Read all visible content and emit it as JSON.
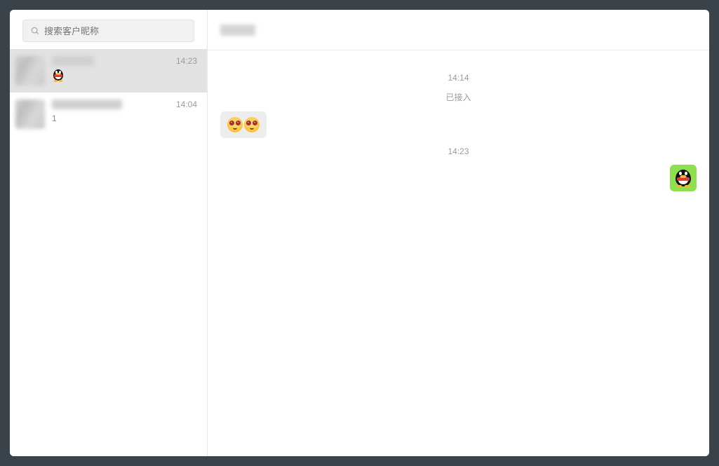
{
  "search": {
    "placeholder": "搜索客户昵称"
  },
  "conversations": [
    {
      "time": "14:23",
      "preview_icon": "penguin-icon",
      "preview_text": ""
    },
    {
      "time": "14:04",
      "preview_icon": null,
      "preview_text": "1"
    }
  ],
  "chat": {
    "timeline": [
      {
        "type": "time",
        "text": "14:14"
      },
      {
        "type": "system",
        "text": "已接入"
      },
      {
        "type": "msg",
        "side": "left",
        "emoji": "angry-eyes",
        "count": 2
      },
      {
        "type": "time",
        "text": "14:23"
      },
      {
        "type": "msg",
        "side": "right",
        "icon": "penguin-icon"
      }
    ]
  },
  "colors": {
    "bubble_right": "#8fe04e",
    "bubble_left": "#ededed"
  }
}
